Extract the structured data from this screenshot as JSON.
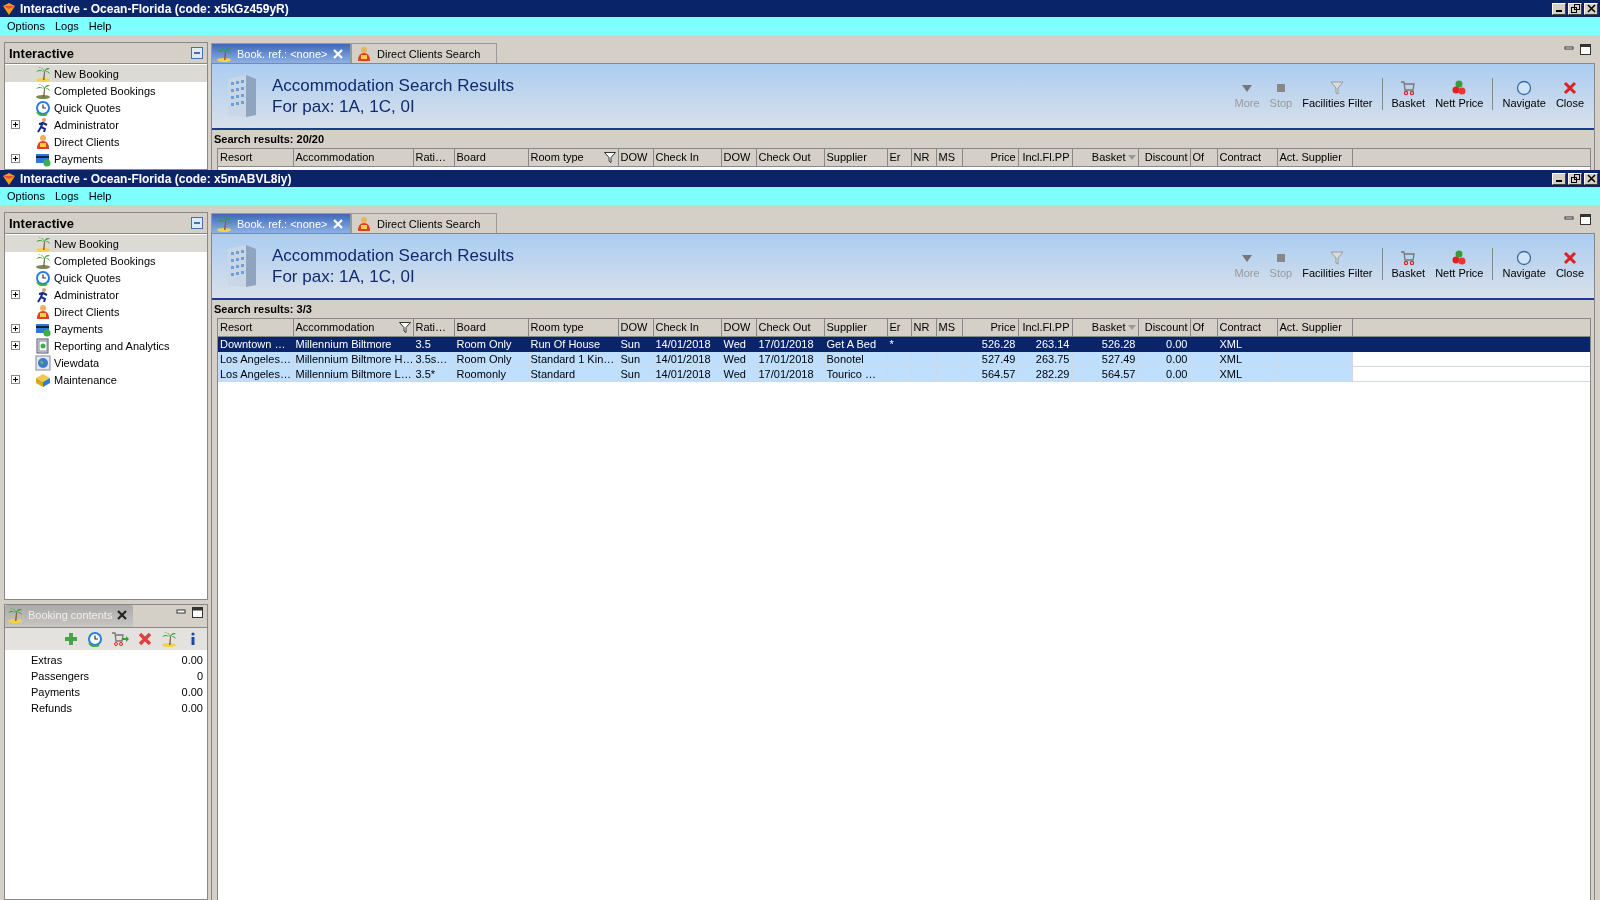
{
  "windows": [
    {
      "title": "Interactive - Ocean-Florida (code: x5kGz459yR)",
      "menu": [
        "Options",
        "Logs",
        "Help"
      ],
      "panel_title": "Interactive",
      "tree": [
        {
          "label": "New Booking",
          "selected": true,
          "expandable": false
        },
        {
          "label": "Completed Bookings",
          "selected": false,
          "expandable": false
        },
        {
          "label": "Quick Quotes",
          "selected": false,
          "expandable": false
        },
        {
          "label": "Administrator",
          "selected": false,
          "expandable": true
        },
        {
          "label": "Direct Clients",
          "selected": false,
          "expandable": false
        },
        {
          "label": "Payments",
          "selected": false,
          "expandable": true
        }
      ],
      "tabs": [
        {
          "label": "Book. ref.: <none>",
          "selected": true,
          "closable": true
        },
        {
          "label": "Direct Clients Search",
          "selected": false,
          "closable": false
        }
      ],
      "header": {
        "title": "Accommodation Search Results",
        "subtitle": "For pax: 1A, 1C, 0I"
      },
      "toolbar": [
        [
          {
            "label": "More",
            "disabled": true
          },
          {
            "label": "Stop",
            "disabled": true
          },
          {
            "label": "Facilities Filter",
            "disabled": false
          }
        ],
        [
          {
            "label": "Basket",
            "disabled": false
          },
          {
            "label": "Nett Price",
            "disabled": false
          }
        ],
        [
          {
            "label": "Navigate",
            "disabled": false
          },
          {
            "label": "Close",
            "disabled": false
          }
        ]
      ],
      "search_results": "Search results: 20/20",
      "columns": [
        {
          "label": "Resort",
          "filter": false,
          "sorted": false
        },
        {
          "label": "Accommodation",
          "filter": false,
          "sorted": false
        },
        {
          "label": "Rati…",
          "filter": false,
          "sorted": false
        },
        {
          "label": "Board",
          "filter": false,
          "sorted": false
        },
        {
          "label": "Room type",
          "filter": true,
          "sorted": false
        },
        {
          "label": "DOW",
          "filter": false,
          "sorted": false
        },
        {
          "label": "Check In",
          "filter": false,
          "sorted": false
        },
        {
          "label": "DOW",
          "filter": false,
          "sorted": false
        },
        {
          "label": "Check Out",
          "filter": false,
          "sorted": false
        },
        {
          "label": "Supplier",
          "filter": false,
          "sorted": false
        },
        {
          "label": "Er",
          "filter": false,
          "sorted": false
        },
        {
          "label": "NR",
          "filter": false,
          "sorted": false
        },
        {
          "label": "MS",
          "filter": false,
          "sorted": false
        },
        {
          "label": "Price",
          "filter": false,
          "sorted": false
        },
        {
          "label": "Incl.Fl.PP",
          "filter": false,
          "sorted": false
        },
        {
          "label": "Basket",
          "filter": false,
          "sorted": true
        },
        {
          "label": "Discount",
          "filter": false,
          "sorted": false
        },
        {
          "label": "Of",
          "filter": false,
          "sorted": false
        },
        {
          "label": "Contract",
          "filter": false,
          "sorted": false
        },
        {
          "label": "Act. Supplier",
          "filter": false,
          "sorted": false
        }
      ]
    },
    {
      "title": "Interactive - Ocean-Florida (code: x5mABVL8iy)",
      "menu": [
        "Options",
        "Logs",
        "Help"
      ],
      "panel_title": "Interactive",
      "tree": [
        {
          "label": "New Booking",
          "selected": true,
          "expandable": false
        },
        {
          "label": "Completed Bookings",
          "selected": false,
          "expandable": false
        },
        {
          "label": "Quick Quotes",
          "selected": false,
          "expandable": false
        },
        {
          "label": "Administrator",
          "selected": false,
          "expandable": true
        },
        {
          "label": "Direct Clients",
          "selected": false,
          "expandable": false
        },
        {
          "label": "Payments",
          "selected": false,
          "expandable": true
        },
        {
          "label": "Reporting and Analytics",
          "selected": false,
          "expandable": true
        },
        {
          "label": "Viewdata",
          "selected": false,
          "expandable": false
        },
        {
          "label": "Maintenance",
          "selected": false,
          "expandable": true
        }
      ],
      "tabs": [
        {
          "label": "Book. ref.: <none>",
          "selected": true,
          "closable": true
        },
        {
          "label": "Direct Clients Search",
          "selected": false,
          "closable": false
        }
      ],
      "header": {
        "title": "Accommodation Search Results",
        "subtitle": "For pax: 1A, 1C, 0I"
      },
      "toolbar": [
        [
          {
            "label": "More",
            "disabled": true
          },
          {
            "label": "Stop",
            "disabled": true
          },
          {
            "label": "Facilities Filter",
            "disabled": false
          }
        ],
        [
          {
            "label": "Basket",
            "disabled": false
          },
          {
            "label": "Nett Price",
            "disabled": false
          }
        ],
        [
          {
            "label": "Navigate",
            "disabled": false
          },
          {
            "label": "Close",
            "disabled": false
          }
        ]
      ],
      "search_results": "Search results: 3/3",
      "columns": [
        {
          "label": "Resort",
          "filter": false,
          "sorted": false
        },
        {
          "label": "Accommodation",
          "filter": true,
          "sorted": false
        },
        {
          "label": "Rati…",
          "filter": false,
          "sorted": false
        },
        {
          "label": "Board",
          "filter": false,
          "sorted": false
        },
        {
          "label": "Room type",
          "filter": false,
          "sorted": false
        },
        {
          "label": "DOW",
          "filter": false,
          "sorted": false
        },
        {
          "label": "Check In",
          "filter": false,
          "sorted": false
        },
        {
          "label": "DOW",
          "filter": false,
          "sorted": false
        },
        {
          "label": "Check Out",
          "filter": false,
          "sorted": false
        },
        {
          "label": "Supplier",
          "filter": false,
          "sorted": false
        },
        {
          "label": "Er",
          "filter": false,
          "sorted": false
        },
        {
          "label": "NR",
          "filter": false,
          "sorted": false
        },
        {
          "label": "MS",
          "filter": false,
          "sorted": false
        },
        {
          "label": "Price",
          "filter": false,
          "sorted": false
        },
        {
          "label": "Incl.Fl.PP",
          "filter": false,
          "sorted": false
        },
        {
          "label": "Basket",
          "filter": false,
          "sorted": true
        },
        {
          "label": "Discount",
          "filter": false,
          "sorted": false
        },
        {
          "label": "Of",
          "filter": false,
          "sorted": false
        },
        {
          "label": "Contract",
          "filter": false,
          "sorted": false
        },
        {
          "label": "Act. Supplier",
          "filter": false,
          "sorted": false
        }
      ],
      "rows": [
        {
          "selected": true,
          "resort": "Downtown …",
          "accommodation": "Millennium Biltmore",
          "rating": "3.5",
          "board": "Room Only",
          "room_type": "Run Of House",
          "dow_in": "Sun",
          "check_in": "14/01/2018",
          "dow_out": "Wed",
          "check_out": "17/01/2018",
          "supplier": "Get A Bed",
          "er": "*",
          "price": "526.28",
          "incl_fl_pp": "263.14",
          "basket": "526.28",
          "discount": "0.00",
          "contract": "XML"
        },
        {
          "selected": false,
          "resort": "Los Angeles…",
          "accommodation": "Millennium Biltmore H…",
          "rating": "3.5s…",
          "board": "Room Only",
          "room_type": "Standard 1 Kin…",
          "dow_in": "Sun",
          "check_in": "14/01/2018",
          "dow_out": "Wed",
          "check_out": "17/01/2018",
          "supplier": "Bonotel",
          "price": "527.49",
          "incl_fl_pp": "263.75",
          "basket": "527.49",
          "discount": "0.00",
          "contract": "XML"
        },
        {
          "selected": false,
          "resort": "Los Angeles…",
          "accommodation": "Millennium Biltmore L…",
          "rating": "3.5*",
          "board": "Roomonly",
          "room_type": "Standard",
          "dow_in": "Sun",
          "check_in": "14/01/2018",
          "dow_out": "Wed",
          "check_out": "17/01/2018",
          "supplier": "Tourico …",
          "price": "564.57",
          "incl_fl_pp": "282.29",
          "basket": "564.57",
          "discount": "0.00",
          "contract": "XML"
        }
      ],
      "booking": {
        "title": "Booking contents",
        "items": [
          {
            "label": "Extras",
            "value": "0.00"
          },
          {
            "label": "Passengers",
            "value": "0"
          },
          {
            "label": "Payments",
            "value": "0.00"
          },
          {
            "label": "Refunds",
            "value": "0.00"
          }
        ]
      }
    }
  ]
}
